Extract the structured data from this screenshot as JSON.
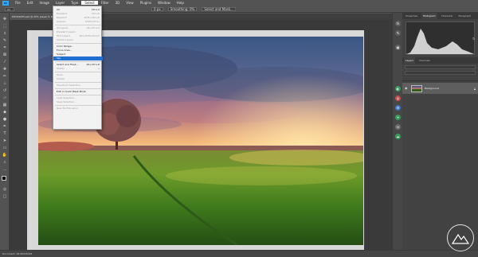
{
  "menubar": {
    "logo": "Ps",
    "items": [
      "File",
      "Edit",
      "Image",
      "Layer",
      "Type",
      "Select",
      "Filter",
      "3D",
      "View",
      "Plugins",
      "Window",
      "Help"
    ],
    "active_index": 5
  },
  "options": {
    "feather_value": "0 px",
    "smoothing": "Smoothing: 0%",
    "select_mask_label": "Select and Mask..."
  },
  "document": {
    "tab_label": "DSC09435.psd @ 25% (Layer 0, RGB/8) *"
  },
  "select_menu": {
    "items": [
      {
        "label": "All",
        "shortcut": "Ctrl+A",
        "disabled": false
      },
      {
        "label": "Deselect",
        "shortcut": "Ctrl+D",
        "disabled": true
      },
      {
        "label": "Reselect",
        "shortcut": "Shift+Ctrl+D",
        "disabled": true
      },
      {
        "label": "Inverse",
        "shortcut": "Shift+Ctrl+I",
        "disabled": true
      },
      {
        "sep": true
      },
      {
        "label": "All Layers",
        "shortcut": "Alt+Ctrl+A",
        "disabled": true
      },
      {
        "label": "Deselect Layers",
        "shortcut": "",
        "disabled": true
      },
      {
        "label": "Find Layers",
        "shortcut": "Alt+Shift+Ctrl+F",
        "disabled": true
      },
      {
        "label": "Isolate Layers",
        "shortcut": "",
        "disabled": true
      },
      {
        "sep": true
      },
      {
        "label": "Color Range...",
        "shortcut": "",
        "disabled": false
      },
      {
        "label": "Focus Area...",
        "shortcut": "",
        "disabled": false
      },
      {
        "label": "Subject",
        "shortcut": "",
        "disabled": false
      },
      {
        "label": "Sky",
        "shortcut": "",
        "disabled": false,
        "highlight": true
      },
      {
        "sep": true
      },
      {
        "label": "Select and Mask...",
        "shortcut": "Alt+Ctrl+R",
        "disabled": false
      },
      {
        "label": "Modify",
        "shortcut": "▸",
        "disabled": true
      },
      {
        "sep": true
      },
      {
        "label": "Grow",
        "shortcut": "",
        "disabled": true
      },
      {
        "label": "Similar",
        "shortcut": "",
        "disabled": true
      },
      {
        "sep": true
      },
      {
        "label": "Transform Selection",
        "shortcut": "",
        "disabled": true
      },
      {
        "sep": true
      },
      {
        "label": "Edit in Quick Mask Mode",
        "shortcut": "",
        "disabled": false
      },
      {
        "sep": true
      },
      {
        "label": "Load Selection...",
        "shortcut": "",
        "disabled": true
      },
      {
        "label": "Save Selection...",
        "shortcut": "",
        "disabled": true
      },
      {
        "sep": true
      },
      {
        "label": "New 3D Extrusion",
        "shortcut": "",
        "disabled": true
      }
    ]
  },
  "panels": {
    "top_tabs": [
      "Properties",
      "Histogram",
      "Character",
      "Paragraph"
    ],
    "top_active": 1,
    "layer_tabs": [
      "Layers",
      "Channels"
    ],
    "layer_active": 0,
    "layer_name": "Background"
  },
  "status": {
    "text": "Document: 48.9M/48.9M"
  },
  "colors": {
    "accent": "#1f6fd1",
    "ps_blue": "#31a8ff"
  },
  "icons": {
    "right_strip": [
      "history-icon",
      "brush-icon",
      "swatch-icon",
      "adjust-icon",
      "globe-icon",
      "settings-icon"
    ]
  }
}
